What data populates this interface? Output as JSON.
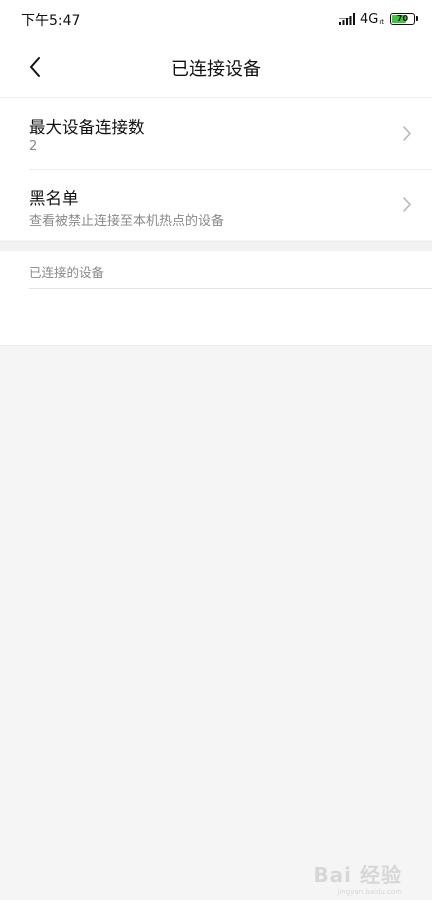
{
  "status_bar": {
    "time": "下午5:47",
    "network": "4G",
    "network_sub": "ıt",
    "battery": "70",
    "battery_level_percent": 70,
    "battery_color": "#3ec63b"
  },
  "header": {
    "title": "已连接设备",
    "back_icon": "chevron-left-icon"
  },
  "settings": [
    {
      "title": "最大设备连接数",
      "value": "2",
      "icon": "chevron-right-icon"
    },
    {
      "title": "黑名单",
      "subtitle": "查看被禁止连接至本机热点的设备",
      "icon": "chevron-right-icon"
    }
  ],
  "connected_section": {
    "label": "已连接的设备"
  },
  "watermark": {
    "text": "Bai 经验",
    "sub": "jingyan.baidu.com"
  }
}
